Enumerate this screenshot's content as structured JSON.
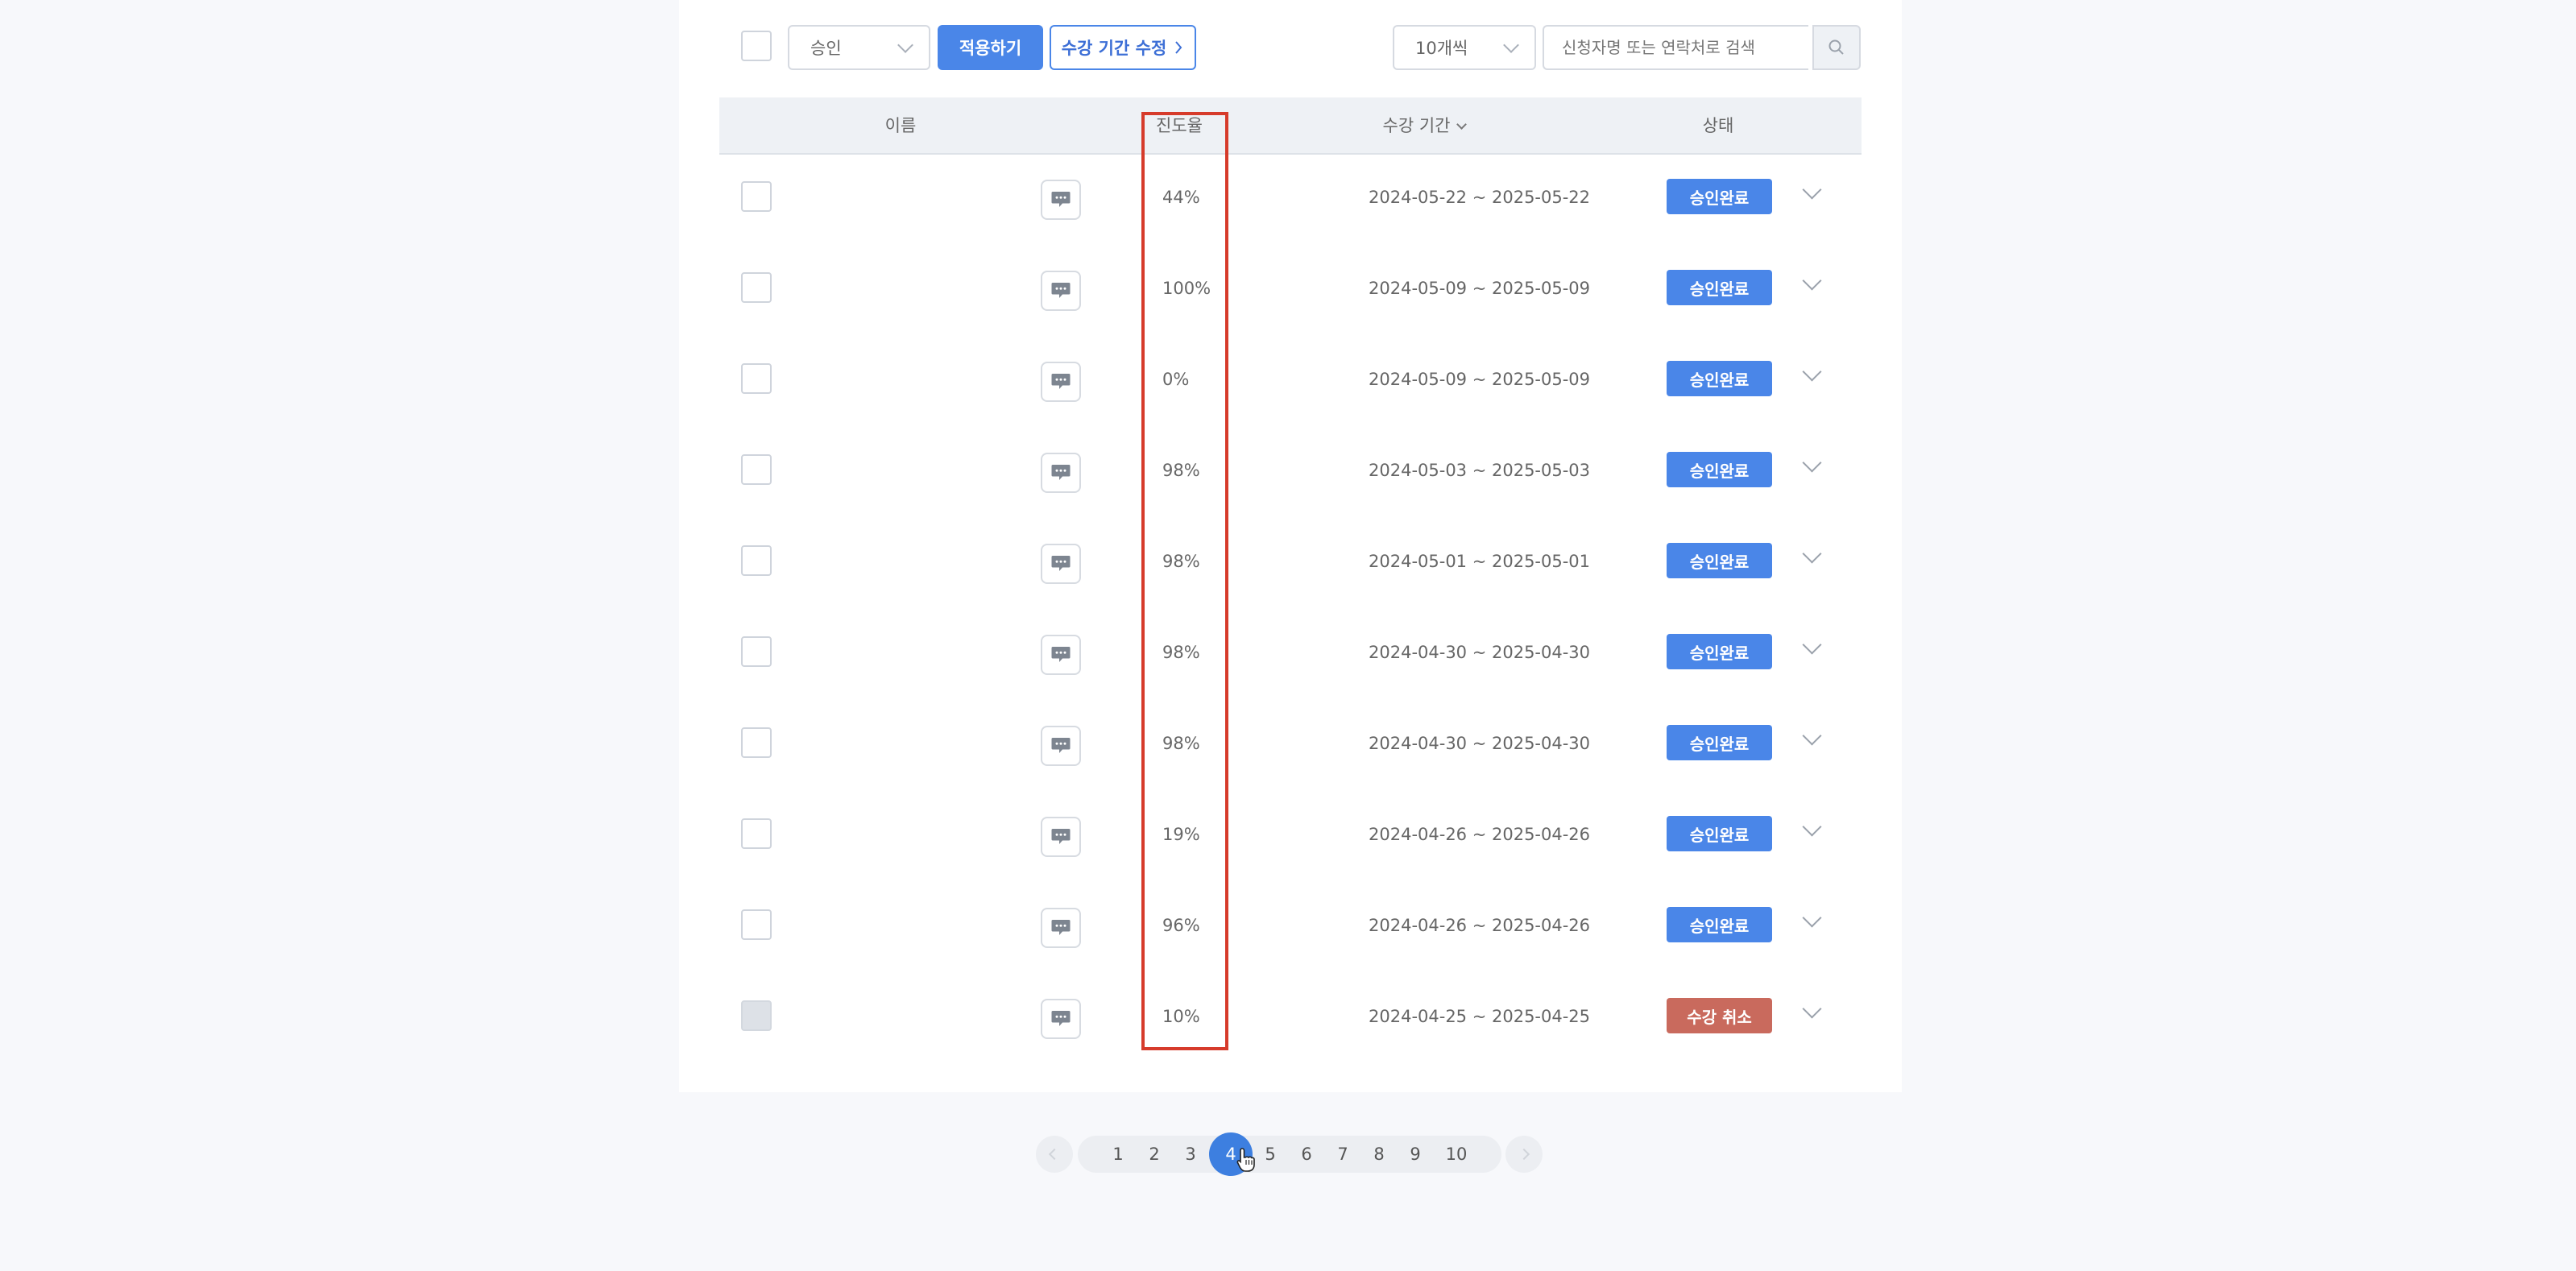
{
  "toolbar": {
    "status_select": "승인",
    "apply_label": "적용하기",
    "edit_period_label": "수강 기간 수정",
    "page_size": "10개씩",
    "search_placeholder": "신청자명 또는 연락처로 검색"
  },
  "table": {
    "headers": {
      "name": "이름",
      "progress": "진도율",
      "period": "수강 기간",
      "status": "상태"
    },
    "rows": [
      {
        "progress": "44%",
        "period": "2024-05-22 ~ 2025-05-22",
        "status": "승인완료",
        "status_type": "approved"
      },
      {
        "progress": "100%",
        "period": "2024-05-09 ~ 2025-05-09",
        "status": "승인완료",
        "status_type": "approved"
      },
      {
        "progress": "0%",
        "period": "2024-05-09 ~ 2025-05-09",
        "status": "승인완료",
        "status_type": "approved"
      },
      {
        "progress": "98%",
        "period": "2024-05-03 ~ 2025-05-03",
        "status": "승인완료",
        "status_type": "approved"
      },
      {
        "progress": "98%",
        "period": "2024-05-01 ~ 2025-05-01",
        "status": "승인완료",
        "status_type": "approved"
      },
      {
        "progress": "98%",
        "period": "2024-04-30 ~ 2025-04-30",
        "status": "승인완료",
        "status_type": "approved"
      },
      {
        "progress": "98%",
        "period": "2024-04-30 ~ 2025-04-30",
        "status": "승인완료",
        "status_type": "approved"
      },
      {
        "progress": "19%",
        "period": "2024-04-26 ~ 2025-04-26",
        "status": "승인완료",
        "status_type": "approved"
      },
      {
        "progress": "96%",
        "period": "2024-04-26 ~ 2025-04-26",
        "status": "승인완료",
        "status_type": "approved"
      },
      {
        "progress": "10%",
        "period": "2024-04-25 ~ 2025-04-25",
        "status": "수강 취소",
        "status_type": "cancelled"
      }
    ]
  },
  "pagination": {
    "pages": [
      "1",
      "2",
      "3",
      "4",
      "5",
      "6",
      "7",
      "8",
      "9",
      "10"
    ],
    "current": "4"
  },
  "colors": {
    "primary": "#4a86e8",
    "cancel": "#c96a5d",
    "highlight": "#d63b2b"
  },
  "icons": {
    "search": "search-icon",
    "chat": "chat-bubble-icon",
    "expand": "chevron-down-icon",
    "cursor": "hand-pointer-icon"
  }
}
